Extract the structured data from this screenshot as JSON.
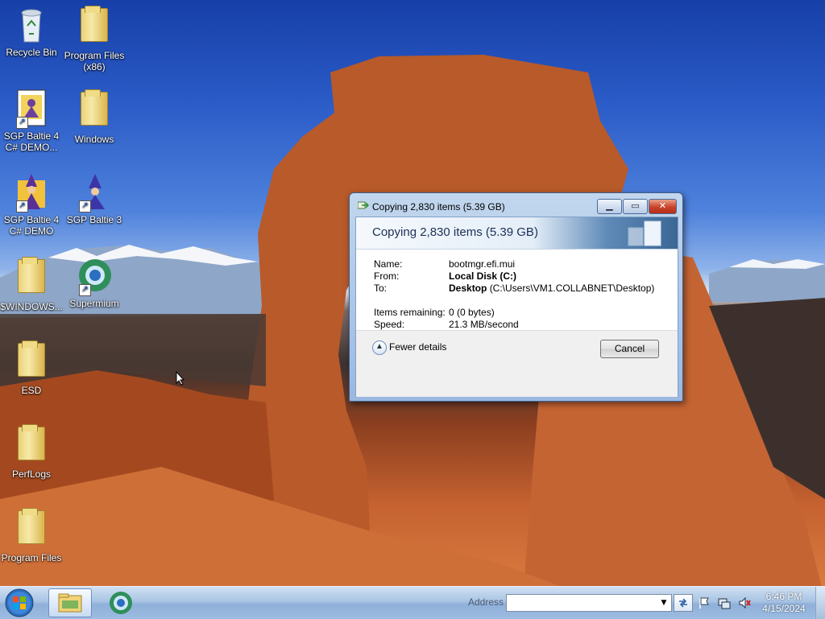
{
  "desktop": {
    "icons": [
      {
        "label": "Recycle Bin",
        "icon": "recycle-bin-icon"
      },
      {
        "label": "Program Files (x86)",
        "icon": "folder-icon"
      },
      {
        "label": "SGP Baltie 4 C# DEMO...",
        "icon": "sgp-baltie-icon",
        "shortcut": true
      },
      {
        "label": "Windows",
        "icon": "folder-icon"
      },
      {
        "label": "SGP Baltie 4 C# DEMO",
        "icon": "sgp-baltie-wizard-icon",
        "shortcut": true
      },
      {
        "label": "SGP Baltie 3",
        "icon": "sgp-baltie-wizard-icon",
        "shortcut": true
      },
      {
        "label": "$WINDOWS...",
        "icon": "folder-icon"
      },
      {
        "label": "Supermium",
        "icon": "supermium-icon",
        "shortcut": true
      },
      {
        "label": "ESD",
        "icon": "folder-icon"
      },
      {
        "label": "PerfLogs",
        "icon": "folder-icon"
      },
      {
        "label": "Program Files",
        "icon": "folder-icon"
      }
    ]
  },
  "dialog": {
    "window_title": "Copying 2,830 items (5.39 GB)",
    "header_title": "Copying 2,830 items (5.39 GB)",
    "name_label": "Name:",
    "name_value": "bootmgr.efi.mui",
    "from_label": "From:",
    "from_value": "Local Disk (C:)",
    "to_label": "To:",
    "to_value_bold": "Desktop",
    "to_value_path": "(C:\\Users\\VM1.COLLABNET\\Desktop)",
    "remaining_label": "Items remaining:",
    "remaining_value": "0 (0 bytes)",
    "speed_label": "Speed:",
    "speed_value": "21.3 MB/second",
    "fewer_details": "Fewer details",
    "cancel": "Cancel",
    "minimize": "▁",
    "maximize": "▭",
    "close": "✕",
    "progress_indeterminate": true
  },
  "taskbar": {
    "address_label": "Address",
    "address_value": "",
    "time": "6:46 PM",
    "date": "4/15/2024"
  },
  "colors": {
    "sky_top": "#173fa8",
    "rock": "#c56230",
    "taskbar": "#a9c4e4",
    "progress_green": "#3bdc3b"
  }
}
